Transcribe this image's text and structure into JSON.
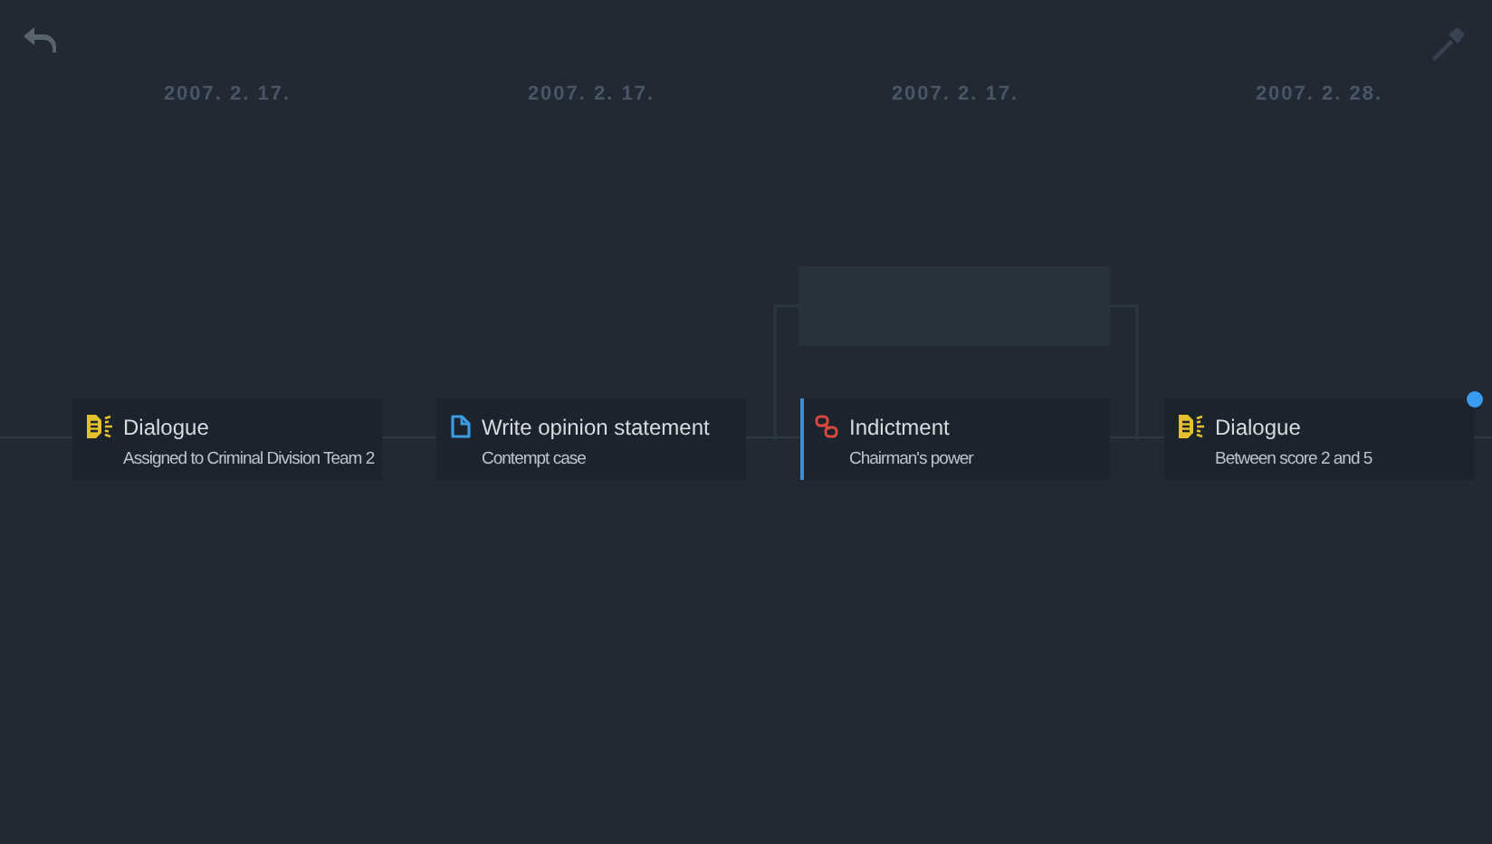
{
  "dates": [
    "2007. 2. 17.",
    "2007. 2. 17.",
    "2007. 2. 17.",
    "2007. 2. 28."
  ],
  "cards": [
    {
      "kind": "dialogue",
      "title": "Dialogue",
      "subtitle": "Assigned to Criminal Division Team 2",
      "selected": false,
      "unread": false
    },
    {
      "kind": "document",
      "title": "Write opinion statement",
      "subtitle": "Contempt case",
      "selected": false,
      "unread": false
    },
    {
      "kind": "indictment",
      "title": "Indictment",
      "subtitle": "Chairman's power",
      "selected": true,
      "unread": false
    },
    {
      "kind": "dialogue",
      "title": "Dialogue",
      "subtitle": "Between score 2 and 5",
      "selected": false,
      "unread": true
    }
  ]
}
